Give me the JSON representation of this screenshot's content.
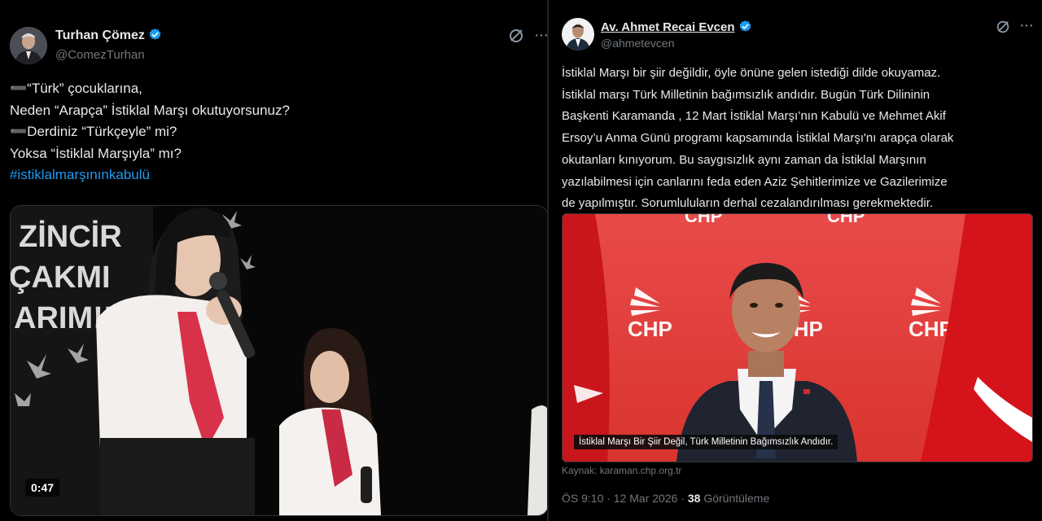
{
  "left_tweet": {
    "author_name": "Turhan Çömez",
    "author_handle": "@ComezTurhan",
    "lines": [
      "➖“Türk” çocuklarına,",
      "Neden “Arapça” İstiklal Marşı okutuyorsunuz?",
      "➖Derdiniz “Türkçeyle” mi?",
      "Yoksa “İstiklal Marşıyla” mı?"
    ],
    "hashtag": "#istiklalmarşınınkabulü",
    "video": {
      "duration": "0:47",
      "background_words": [
        "ZİNCİR",
        "ÇAKMI",
        "ARIM!!"
      ]
    }
  },
  "right_tweet": {
    "author_name": "Av. Ahmet Recai Evcen",
    "author_handle": "@ahmetevcen",
    "lines": [
      "İstiklal Marşı bir şiir değildir, öyle önüne gelen istediği dilde okuyamaz.",
      "İstiklal marşı Türk Milletinin bağımsızlık andıdır. Bugün Türk Dilininin",
      "Başkenti Karamanda , 12 Mart İstiklal Marşı’nın Kabulü ve Mehmet Akif",
      "Ersoy’u Anma Günü programı kapsamında İstiklal Marşı'nı arapça olarak",
      "okutanları kınıyorum. Bu saygısızlık aynı zaman da İstiklal Marşının",
      "yazılabilmesi için canlarını feda eden Aziz Şehitlerimize ve Gazilerimize",
      "de yapılmıştır. Sorumluluların derhal cezalandırılması gerekmektedir."
    ],
    "image": {
      "caption": "İstiklal Marşı Bir Şiir Değil, Türk Milletinin Bağımsızlık Andıdır.",
      "logo_text": "CHP"
    },
    "source_label": "Kaynak: karaman.chp.org.tr",
    "timestamp": "ÖS 9:10 · 12 Mar 2026 ·",
    "views_count": "38",
    "views_label": "Görüntüleme"
  },
  "icons": {
    "verified": "verified-badge-icon",
    "grok": "grok-icon",
    "more": "more-options-icon"
  },
  "colors": {
    "background": "#000000",
    "text": "#e7e9ea",
    "secondary": "#71767b",
    "link": "#1d9bf0",
    "verified": "#1d9bf0",
    "chp_red": "#e4302f",
    "flag_red": "#d8171e"
  }
}
